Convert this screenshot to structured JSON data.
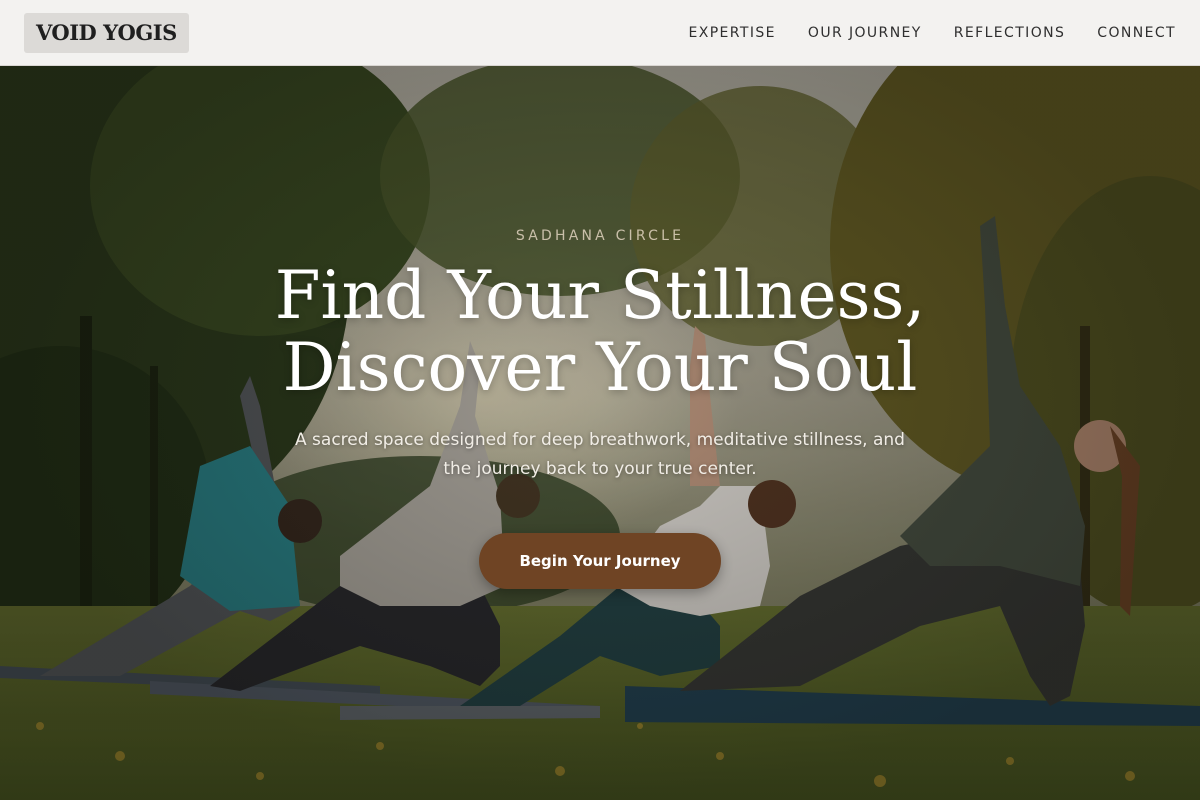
{
  "brand": {
    "logo_text": "VOID YOGIS"
  },
  "nav": {
    "items": [
      {
        "label": "EXPERTISE"
      },
      {
        "label": "OUR JOURNEY"
      },
      {
        "label": "REFLECTIONS"
      },
      {
        "label": "CONNECT"
      }
    ]
  },
  "hero": {
    "eyebrow": "SADHANA CIRCLE",
    "headline_line1": "Find Your Stillness,",
    "headline_line2": "Discover Your Soul",
    "subtext_line1": "A sacred space designed for deep breathwork, meditative stillness, and",
    "subtext_line2": "the journey back to your true center.",
    "cta_label": "Begin Your Journey",
    "image_icon": "outdoor-yoga-class-photo"
  },
  "colors": {
    "header_bg": "#f3f2f0",
    "cta_bg": "#6f4424",
    "eyebrow": "#e1d2be",
    "headline": "#ffffff"
  }
}
